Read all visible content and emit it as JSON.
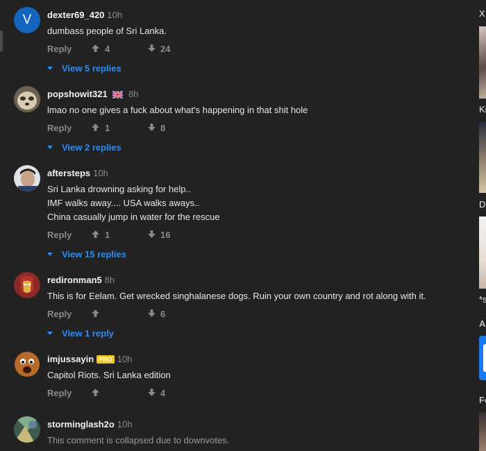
{
  "comments": [
    {
      "username": "dexter69_420",
      "time": "10h",
      "avatar_letter": "V",
      "lines": [
        "dumbass people of Sri Lanka."
      ],
      "reply_label": "Reply",
      "upvotes": "4",
      "downvotes": "24",
      "view_replies": "View 5 replies"
    },
    {
      "username": "popshowit321",
      "time": "8h",
      "flag": "uk-flag-icon",
      "lines": [
        "lmao no one gives a fuck about what's happening in that shit hole"
      ],
      "reply_label": "Reply",
      "upvotes": "1",
      "downvotes": "8",
      "view_replies": "View 2 replies"
    },
    {
      "username": "aftersteps",
      "time": "10h",
      "lines": [
        "Sri Lanka drowning asking for help..",
        "IMF walks away.... USA walks aways..",
        "China casually jump in water for the rescue"
      ],
      "reply_label": "Reply",
      "upvotes": "1",
      "downvotes": "16",
      "view_replies": "View 15 replies"
    },
    {
      "username": "redironman5",
      "time": "8h",
      "lines": [
        "This is for Eelam. Get wrecked singhalanese dogs. Ruin your own country and rot along with it."
      ],
      "reply_label": "Reply",
      "upvotes": "",
      "downvotes": "6",
      "view_replies": "View 1 reply"
    },
    {
      "username": "imjussayin",
      "time": "10h",
      "badge": "PRO",
      "lines": [
        "Capitol Riots. Sri Lanka edition"
      ],
      "reply_label": "Reply",
      "upvotes": "",
      "downvotes": "4"
    },
    {
      "username": "storminglash2o",
      "time": "10h",
      "lines": [
        "This comment is collapsed due to downvotes."
      ]
    }
  ],
  "rail": {
    "letters": [
      "X",
      "Ki",
      "D",
      "*s",
      "A",
      "Fe"
    ]
  },
  "colors": {
    "background": "#222222",
    "link_blue": "#2f8bef",
    "muted": "#8a8a8a",
    "pro_badge": "#f2c71c",
    "avatar_blue": "#1565c0"
  }
}
